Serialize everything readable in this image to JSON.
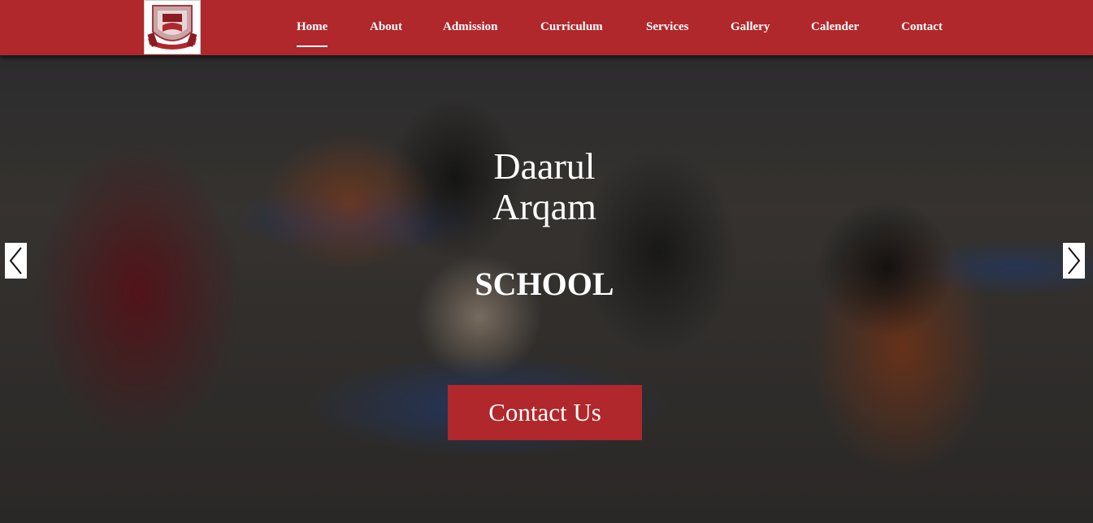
{
  "brand": {
    "logo_icon": "school-crest-logo",
    "primary_color": "#b0282b"
  },
  "nav": {
    "items": [
      {
        "label": "Home",
        "active": true
      },
      {
        "label": "About",
        "active": false
      },
      {
        "label": "Admission",
        "active": false
      },
      {
        "label": "Curriculum",
        "active": false
      },
      {
        "label": "Services",
        "active": false
      },
      {
        "label": "Gallery",
        "active": false
      },
      {
        "label": "Calender",
        "active": false
      },
      {
        "label": "Contact",
        "active": false
      }
    ]
  },
  "hero": {
    "title_line1": "Daarul",
    "title_line2": "Arqam",
    "subtitle": "SCHOOL",
    "cta_label": "Contact Us",
    "prev_icon": "chevron-left-icon",
    "next_icon": "chevron-right-icon"
  }
}
